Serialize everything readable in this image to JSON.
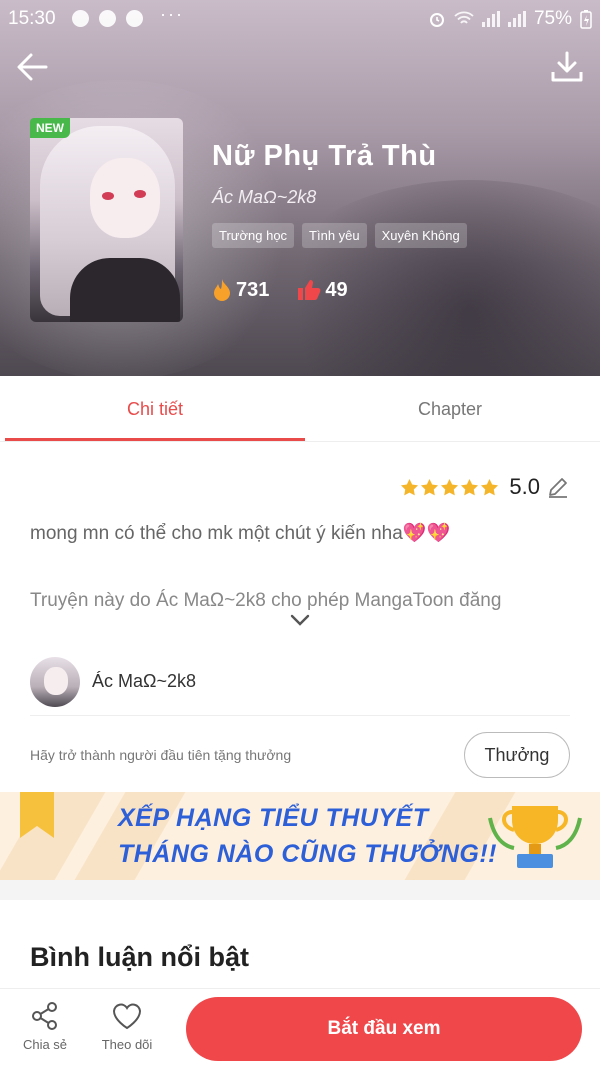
{
  "status_bar": {
    "time": "15:30",
    "more": "···",
    "battery": "75%"
  },
  "book": {
    "badge": "NEW",
    "title": "Nữ Phụ Trả Thù",
    "author": "Ác MaΩ~2k8",
    "tags": [
      "Trường học",
      "Tình yêu",
      "Xuyên Không"
    ],
    "views": "731",
    "likes": "49"
  },
  "tabs": {
    "details": "Chi tiết",
    "chapter": "Chapter"
  },
  "detail": {
    "rating": "5.0",
    "description": "mong mn có thể cho mk một chút ý kiến nha💖💖",
    "license": "Truyện này do Ác MaΩ~2k8 cho phép MangaToon đăng",
    "author_name": "Ác MaΩ~2k8",
    "reward_prompt": "Hãy trở thành người đầu tiên tặng thưởng",
    "reward_button": "Thưởng"
  },
  "banner": {
    "line1": "XẾP HẠNG TIỂU THUYẾT",
    "line2": "THÁNG NÀO CŨNG THƯỞNG!!"
  },
  "comments": {
    "title": "Bình luận nổi bật"
  },
  "bottom_bar": {
    "share": "Chia sẻ",
    "follow": "Theo dõi",
    "start": "Bắt đầu xem"
  },
  "colors": {
    "accent": "#e94b4b",
    "start_button": "#f0474a",
    "banner_text": "#2c5fd8",
    "star": "#f5b52b",
    "new_badge": "#48b84a"
  }
}
